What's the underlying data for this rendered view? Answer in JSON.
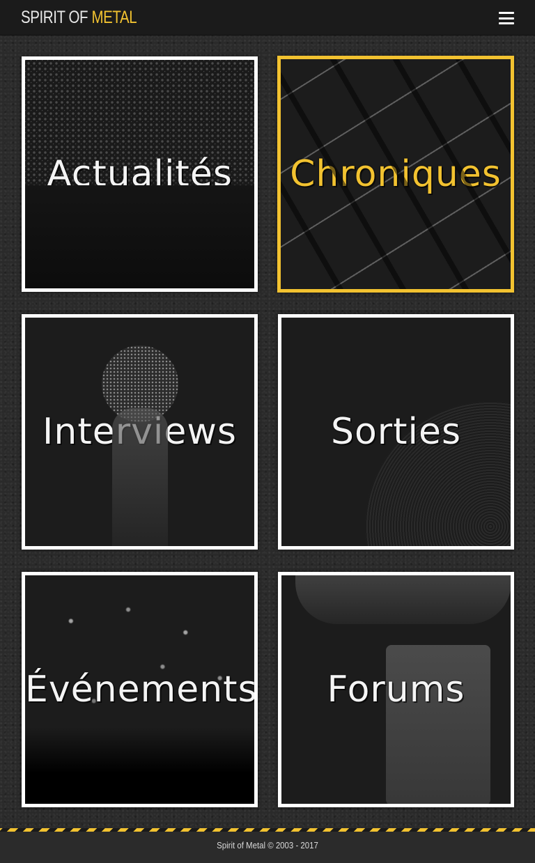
{
  "header": {
    "logo_white": "SPIRIT OF",
    "logo_yellow": "METAL",
    "menu_icon": "hamburger-menu-icon"
  },
  "tiles": [
    {
      "label": "Actualités",
      "active": false
    },
    {
      "label": "Chroniques",
      "active": true
    },
    {
      "label": "Interviews",
      "active": false
    },
    {
      "label": "Sorties",
      "active": false
    },
    {
      "label": "Événements",
      "active": false
    },
    {
      "label": "Forums",
      "active": false
    }
  ],
  "colors": {
    "accent": "#f2c230",
    "background": "#2a2a2a",
    "tile_border": "#ffffff"
  },
  "footer": {
    "copyright": "Spirit of Metal © 2003 - 2017"
  }
}
